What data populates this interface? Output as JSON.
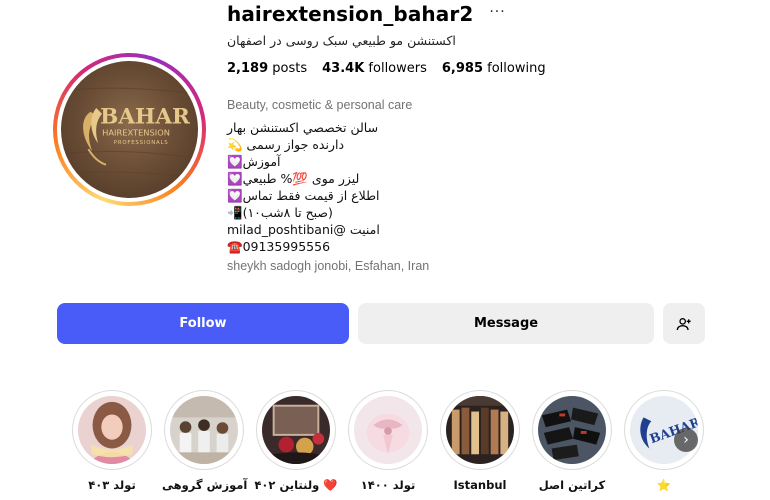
{
  "profile": {
    "username": "hairextension_bahar2",
    "more_label": "···",
    "full_name": "اکستنشن مو طبیعي سبک روسی در اصفهان",
    "stats": {
      "posts": {
        "count": "2,189",
        "label": "posts"
      },
      "followers": {
        "count": "43.4K",
        "label": "followers"
      },
      "following": {
        "count": "6,985",
        "label": "following"
      }
    },
    "category": "Beauty, cosmetic & personal care",
    "bio_lines": [
      "سالن تخصصي اکستنشن بهار",
      "💫 دارنده جواز رسمی",
      "💟آموزش",
      "💟لیزر موی 💯% طبیعي",
      "💟اطلاع از قیمت فقط تماس",
      "📲(۱۰صبح تا ۸شب)",
      "milad_poshtibani@ امنیت",
      "☎️09135995556"
    ],
    "location": "sheykh sadogh jonobi, Esfahan, Iran",
    "avatar_text": {
      "line1": "BAHAR",
      "line2": "HAIREXTENSION",
      "line3": "PROFESSIONALS"
    }
  },
  "actions": {
    "follow_label": "Follow",
    "message_label": "Message",
    "add_user_icon": "person-add-icon"
  },
  "highlights": [
    {
      "label": "تولد ۴۰۳"
    },
    {
      "label": "آموزش گروهی"
    },
    {
      "label": "ولنتاین ۴۰۲ ❤️"
    },
    {
      "label": "تولد ۱۴۰۰"
    },
    {
      "label": "Istanbul"
    },
    {
      "label": "کراتین اصل"
    },
    {
      "label": "⭐"
    }
  ],
  "colors": {
    "follow_button": "#4a5cf7",
    "secondary_button": "#efefef",
    "muted_text": "#737373"
  }
}
